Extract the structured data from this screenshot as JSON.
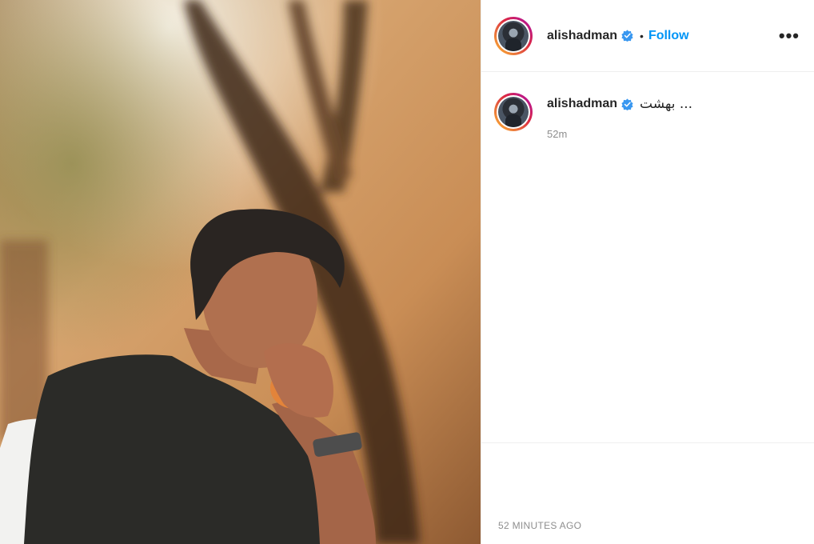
{
  "post": {
    "author": "alishadman",
    "verified": true,
    "follow_label": "Follow",
    "more_label": "•••",
    "caption": "بهشت ...",
    "relative_time": "52m",
    "timestamp": "52 MINUTES AGO"
  },
  "colors": {
    "follow": "#0095f6",
    "verified": "#3897f0",
    "muted": "#8e8e8e"
  },
  "icons": [
    "verified-badge-icon",
    "more-options-icon"
  ]
}
